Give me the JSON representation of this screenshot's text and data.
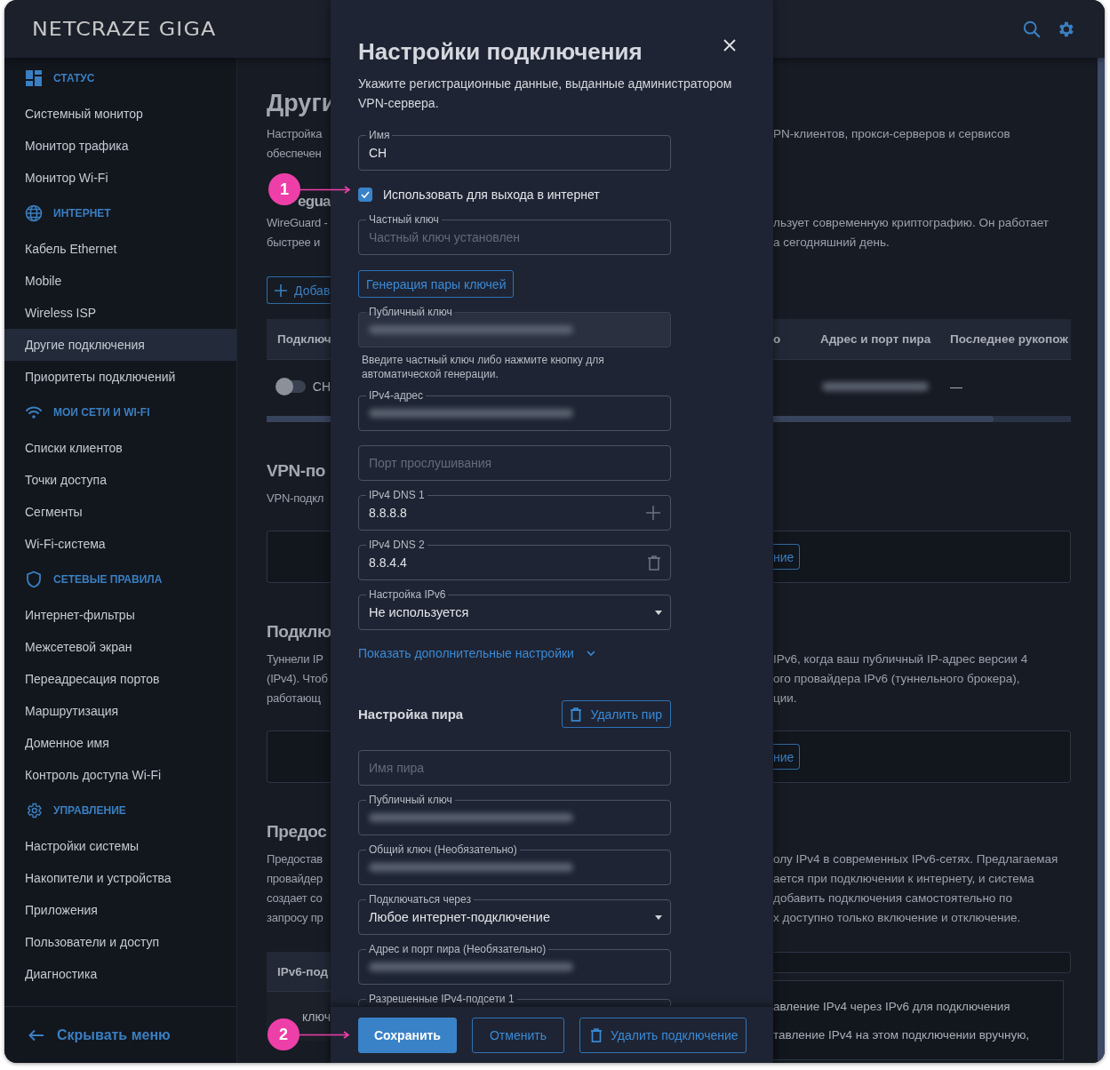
{
  "header": {
    "logo": "NETCRAZE GIGA"
  },
  "sidebar": {
    "sections": [
      {
        "title": "СТАТУС",
        "items": [
          {
            "label": "Системный монитор",
            "selected": false
          },
          {
            "label": "Монитор трафика",
            "selected": false
          },
          {
            "label": "Монитор Wi-Fi",
            "selected": false
          }
        ]
      },
      {
        "title": "ИНТЕРНЕТ",
        "items": [
          {
            "label": "Кабель Ethernet",
            "selected": false
          },
          {
            "label": "Mobile",
            "selected": false
          },
          {
            "label": "Wireless ISP",
            "selected": false
          },
          {
            "label": "Другие подключения",
            "selected": true
          },
          {
            "label": "Приоритеты подключений",
            "selected": false
          }
        ]
      },
      {
        "title": "МОИ СЕТИ И WI-FI",
        "items": [
          {
            "label": "Списки клиентов",
            "selected": false
          },
          {
            "label": "Точки доступа",
            "selected": false
          },
          {
            "label": "Сегменты",
            "selected": false
          },
          {
            "label": "Wi-Fi-система",
            "selected": false
          }
        ]
      },
      {
        "title": "СЕТЕВЫЕ ПРАВИЛА",
        "items": [
          {
            "label": "Интернет-фильтры",
            "selected": false
          },
          {
            "label": "Межсетевой экран",
            "selected": false
          },
          {
            "label": "Переадресация портов",
            "selected": false
          },
          {
            "label": "Маршрутизация",
            "selected": false
          },
          {
            "label": "Доменное имя",
            "selected": false
          },
          {
            "label": "Контроль доступа Wi-Fi",
            "selected": false
          }
        ]
      },
      {
        "title": "УПРАВЛЕНИЕ",
        "items": [
          {
            "label": "Настройки системы",
            "selected": false
          },
          {
            "label": "Накопители и устройства",
            "selected": false
          },
          {
            "label": "Приложения",
            "selected": false
          },
          {
            "label": "Пользователи и доступ",
            "selected": false
          },
          {
            "label": "Диагностика",
            "selected": false
          }
        ]
      }
    ],
    "collapse": "Скрывать меню"
  },
  "main": {
    "blocks": [
      {
        "kind": "title",
        "left": "Други"
      },
      {
        "kind": "text",
        "left": [
          "Настройка",
          "обеспечен"
        ],
        "right": [
          "PN-клиентов, прокси-серверов и сервисов"
        ]
      },
      {
        "kind": "heading",
        "left": "egua"
      },
      {
        "kind": "text",
        "left": [
          "WireGuard -",
          "быстрее и"
        ],
        "right": [
          "льзует современную криптографию. Он работает",
          "а сегодняшний день."
        ]
      },
      {
        "kind": "button",
        "left": "Добав"
      },
      {
        "kind": "table_header",
        "left": "Подключ",
        "right": [
          "о",
          "Адрес и порт пира",
          "Последнее рукопож"
        ]
      },
      {
        "kind": "table_row",
        "on": false,
        "left": "CH",
        "blurred": true,
        "right": [
          "—"
        ]
      },
      {
        "kind": "scrollbar"
      },
      {
        "kind": "heading",
        "left": "VPN-по"
      },
      {
        "kind": "text",
        "left": [
          "VPN-подкл"
        ]
      },
      {
        "kind": "card",
        "right": "ние"
      },
      {
        "kind": "heading",
        "left": "Подклю"
      },
      {
        "kind": "text",
        "left": [
          "Туннели IP",
          "(IPv4). Чтоб",
          "работающ"
        ],
        "right": [
          "IPv6, когда ваш публичный IP-адрес версии 4",
          "ого провайдера IPv6 (туннельного брокера),",
          "ции."
        ]
      },
      {
        "kind": "card",
        "right": "ние"
      },
      {
        "kind": "heading",
        "left": "Предос"
      },
      {
        "kind": "text",
        "left": [
          "Предостав",
          "провайдер",
          "создает со",
          "запросу пр"
        ],
        "right": [
          "олу IPv4 в современных IPv6-сетях. Предлагаемая",
          "ается при подключении к интернету, и система",
          "добавить подключения самостоятельно по",
          "х доступно только включение и отключение."
        ]
      },
      {
        "kind": "ipv6_table",
        "left": "IPv6-под",
        "row": "ключ",
        "right": [
          "авление IPv4 через IPv6 для подключения",
          "тавление IPv4 на этом подключении вручную,"
        ]
      }
    ]
  },
  "dialog": {
    "title": "Настройки подключения",
    "description": "Укажите регистрационные данные, выданные администратором VPN-сервера.",
    "items": [
      {
        "kind": "field",
        "label": "Имя",
        "value": "CH"
      },
      {
        "kind": "checkbox",
        "label": "Использовать для выхода в интернет",
        "checked": true
      },
      {
        "kind": "field",
        "label": "Частный ключ",
        "placeholder": "Частный ключ установлен"
      },
      {
        "kind": "button",
        "label": "Генерация пары ключей"
      },
      {
        "kind": "field",
        "label": "Публичный ключ",
        "blurred": true,
        "disabled": true
      },
      {
        "kind": "hint",
        "text": "Введите частный ключ либо нажмите кнопку для автоматической генерации."
      },
      {
        "kind": "field",
        "label": "IPv4-адрес",
        "blurred": true
      },
      {
        "kind": "field",
        "placeholder": "Порт прослушивания"
      },
      {
        "kind": "field",
        "label": "IPv4 DNS 1",
        "value": "8.8.8.8",
        "addable": true
      },
      {
        "kind": "field",
        "label": "IPv4 DNS 2",
        "value": "8.8.4.4",
        "removable": true
      },
      {
        "kind": "select",
        "label": "Настройка IPv6",
        "value": "Не используется"
      },
      {
        "kind": "link",
        "label": "Показать дополнительные настройки",
        "expanded": false
      },
      {
        "kind": "section",
        "title": "Настройка пира",
        "button": "Удалить пир"
      },
      {
        "kind": "field",
        "placeholder": "Имя пира"
      },
      {
        "kind": "field",
        "label": "Публичный ключ",
        "blurred": true
      },
      {
        "kind": "field",
        "label": "Общий ключ (Необязательно)",
        "blurred": true
      },
      {
        "kind": "select",
        "label": "Подключаться через",
        "value": "Любое интернет-подключение"
      },
      {
        "kind": "field",
        "label": "Адрес и порт пира (Необязательно)",
        "blurred": true
      },
      {
        "kind": "field",
        "label": "Разрешенные IPv4-подсети 1"
      }
    ],
    "buttons": [
      {
        "kind": "primary",
        "label": "Сохранить"
      },
      {
        "kind": "outline",
        "label": "Отменить"
      },
      {
        "kind": "delete",
        "label": "Удалить подключение"
      }
    ]
  },
  "annotations": [
    {
      "number": "1"
    },
    {
      "number": "2"
    }
  ]
}
